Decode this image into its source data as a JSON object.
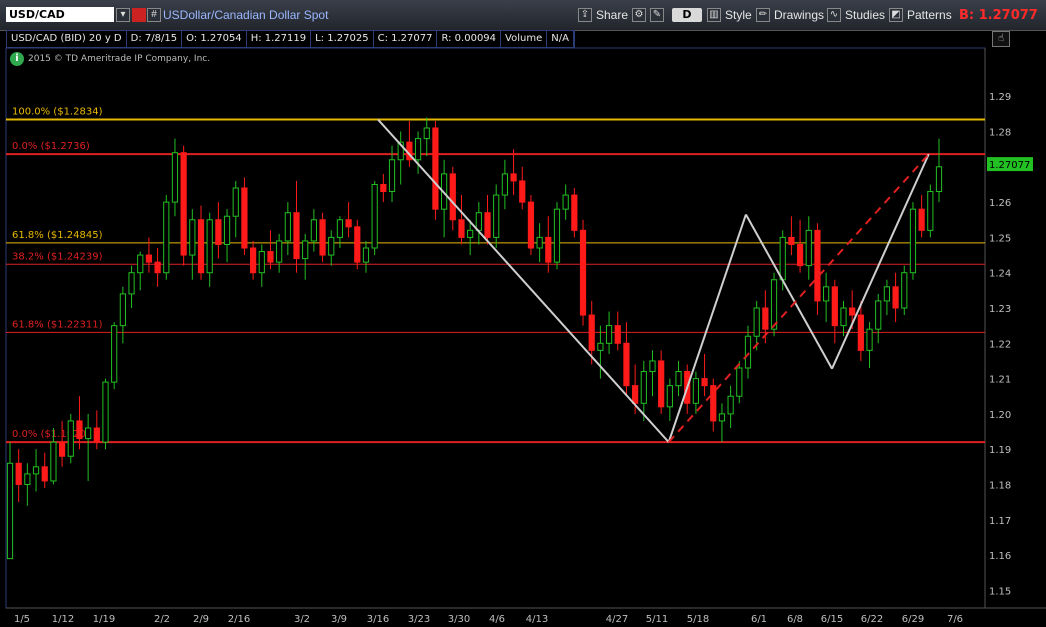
{
  "toolbar": {
    "symbol": "USD/CAD",
    "description": "USDollar/Canadian Dollar Spot",
    "share": "Share",
    "period_button": "D",
    "style": "Style",
    "drawings": "Drawings",
    "studies": "Studies",
    "patterns": "Patterns",
    "bid_label": "B: 1.27077",
    "hash_button": "#"
  },
  "info": {
    "instrument": "USD/CAD (BID) 20 y D",
    "date": "D: 7/8/15",
    "open": "O: 1.27054",
    "high": "H: 1.27119",
    "low": "L: 1.27025",
    "close": "C: 1.27077",
    "range": "R: 0.00094",
    "volume": "Volume",
    "na": "N/A"
  },
  "copyright": "2015 © TD Ameritrade IP Company, Inc.",
  "colors": {
    "up": "#22c022",
    "down": "#ff1a1a",
    "fib_gold": "#e8b800",
    "fib_red": "#e02020",
    "pattern": "#cfcfcf"
  },
  "chart_data": {
    "type": "candlestick",
    "ylim": [
      1.145,
      1.298
    ],
    "y_ticks": [
      1.29,
      1.28,
      1.27,
      1.26,
      1.25,
      1.24,
      1.23,
      1.22,
      1.21,
      1.2,
      1.19,
      1.18,
      1.17,
      1.16,
      1.15
    ],
    "x_ticks": [
      "1/5",
      "1/12",
      "1/19",
      "2/2",
      "2/9",
      "2/16",
      "3/2",
      "3/9",
      "3/16",
      "3/23",
      "3/30",
      "4/6",
      "4/13",
      "4/27",
      "5/11",
      "5/18",
      "6/1",
      "6/8",
      "6/15",
      "6/22",
      "6/29",
      "7/6"
    ],
    "last_price": "1.27077",
    "fib_levels": [
      {
        "label": "100.0%  ($1.2834)",
        "value": 1.2834,
        "color": "gold",
        "thick": true
      },
      {
        "label": "0.0%  ($1.2736)",
        "value": 1.2736,
        "color": "red",
        "thick": true
      },
      {
        "label": "61.8%  ($1.24845)",
        "value": 1.24845,
        "color": "gold",
        "thick": false
      },
      {
        "label": "38.2%  ($1.24239)",
        "value": 1.24239,
        "color": "red",
        "thick": false
      },
      {
        "label": "61.8%  ($1.22311)",
        "value": 1.22311,
        "color": "red",
        "thick": false
      },
      {
        "label": "0.0%  ($1.1920)",
        "value": 1.192,
        "color": "red",
        "thick": true
      }
    ],
    "pattern_lines": [
      {
        "from": [
          "3/16",
          1.2834
        ],
        "to": [
          "5/13",
          1.192
        ],
        "style": "solid"
      },
      {
        "from": [
          "5/13",
          1.192
        ],
        "to": [
          "5/29",
          1.2565
        ],
        "style": "solid"
      },
      {
        "from": [
          "5/29",
          1.2565
        ],
        "to": [
          "6/15",
          1.2128
        ],
        "style": "solid"
      },
      {
        "from": [
          "6/15",
          1.2128
        ],
        "to": [
          "7/1",
          1.2736
        ],
        "style": "solid"
      },
      {
        "from": [
          "5/13",
          1.192
        ],
        "to": [
          "7/1",
          1.2736
        ],
        "style": "dashed"
      }
    ],
    "candles": [
      [
        1.159,
        1.192,
        1.16,
        1.186
      ],
      [
        1.186,
        1.19,
        1.175,
        1.18
      ],
      [
        1.18,
        1.186,
        1.174,
        1.183
      ],
      [
        1.183,
        1.19,
        1.178,
        1.185
      ],
      [
        1.185,
        1.189,
        1.179,
        1.181
      ],
      [
        1.181,
        1.196,
        1.18,
        1.192
      ],
      [
        1.192,
        1.198,
        1.185,
        1.188
      ],
      [
        1.188,
        1.2,
        1.186,
        1.198
      ],
      [
        1.198,
        1.205,
        1.19,
        1.193
      ],
      [
        1.193,
        1.2,
        1.181,
        1.196
      ],
      [
        1.196,
        1.201,
        1.19,
        1.192
      ],
      [
        1.192,
        1.21,
        1.19,
        1.209
      ],
      [
        1.209,
        1.226,
        1.207,
        1.225
      ],
      [
        1.225,
        1.236,
        1.22,
        1.234
      ],
      [
        1.234,
        1.242,
        1.23,
        1.24
      ],
      [
        1.24,
        1.246,
        1.235,
        1.245
      ],
      [
        1.245,
        1.25,
        1.24,
        1.243
      ],
      [
        1.243,
        1.247,
        1.236,
        1.24
      ],
      [
        1.24,
        1.262,
        1.238,
        1.26
      ],
      [
        1.26,
        1.278,
        1.256,
        1.274
      ],
      [
        1.274,
        1.276,
        1.242,
        1.245
      ],
      [
        1.245,
        1.258,
        1.238,
        1.255
      ],
      [
        1.255,
        1.259,
        1.238,
        1.24
      ],
      [
        1.24,
        1.257,
        1.236,
        1.255
      ],
      [
        1.255,
        1.26,
        1.244,
        1.248
      ],
      [
        1.248,
        1.258,
        1.243,
        1.256
      ],
      [
        1.256,
        1.266,
        1.25,
        1.264
      ],
      [
        1.264,
        1.267,
        1.245,
        1.247
      ],
      [
        1.247,
        1.249,
        1.238,
        1.24
      ],
      [
        1.24,
        1.248,
        1.236,
        1.246
      ],
      [
        1.246,
        1.252,
        1.241,
        1.243
      ],
      [
        1.243,
        1.251,
        1.24,
        1.249
      ],
      [
        1.249,
        1.26,
        1.245,
        1.257
      ],
      [
        1.257,
        1.266,
        1.24,
        1.244
      ],
      [
        1.244,
        1.251,
        1.238,
        1.249
      ],
      [
        1.249,
        1.258,
        1.246,
        1.255
      ],
      [
        1.255,
        1.257,
        1.243,
        1.245
      ],
      [
        1.245,
        1.252,
        1.242,
        1.25
      ],
      [
        1.25,
        1.256,
        1.247,
        1.255
      ],
      [
        1.255,
        1.26,
        1.25,
        1.253
      ],
      [
        1.253,
        1.255,
        1.241,
        1.243
      ],
      [
        1.243,
        1.249,
        1.24,
        1.247
      ],
      [
        1.247,
        1.266,
        1.245,
        1.265
      ],
      [
        1.265,
        1.268,
        1.26,
        1.263
      ],
      [
        1.263,
        1.276,
        1.26,
        1.272
      ],
      [
        1.272,
        1.28,
        1.265,
        1.277
      ],
      [
        1.277,
        1.283,
        1.27,
        1.272
      ],
      [
        1.272,
        1.28,
        1.268,
        1.278
      ],
      [
        1.278,
        1.284,
        1.273,
        1.281
      ],
      [
        1.281,
        1.283,
        1.255,
        1.258
      ],
      [
        1.258,
        1.272,
        1.25,
        1.268
      ],
      [
        1.268,
        1.27,
        1.252,
        1.255
      ],
      [
        1.255,
        1.262,
        1.248,
        1.25
      ],
      [
        1.25,
        1.255,
        1.245,
        1.252
      ],
      [
        1.252,
        1.26,
        1.248,
        1.257
      ],
      [
        1.257,
        1.262,
        1.248,
        1.25
      ],
      [
        1.25,
        1.265,
        1.247,
        1.262
      ],
      [
        1.262,
        1.272,
        1.258,
        1.268
      ],
      [
        1.268,
        1.275,
        1.262,
        1.266
      ],
      [
        1.266,
        1.27,
        1.258,
        1.26
      ],
      [
        1.26,
        1.262,
        1.245,
        1.247
      ],
      [
        1.247,
        1.254,
        1.243,
        1.25
      ],
      [
        1.25,
        1.256,
        1.24,
        1.243
      ],
      [
        1.243,
        1.26,
        1.241,
        1.258
      ],
      [
        1.258,
        1.265,
        1.255,
        1.262
      ],
      [
        1.262,
        1.264,
        1.25,
        1.252
      ],
      [
        1.252,
        1.255,
        1.225,
        1.228
      ],
      [
        1.228,
        1.232,
        1.214,
        1.218
      ],
      [
        1.218,
        1.225,
        1.21,
        1.22
      ],
      [
        1.22,
        1.229,
        1.217,
        1.225
      ],
      [
        1.225,
        1.229,
        1.218,
        1.22
      ],
      [
        1.22,
        1.226,
        1.205,
        1.208
      ],
      [
        1.208,
        1.214,
        1.2,
        1.203
      ],
      [
        1.203,
        1.215,
        1.198,
        1.212
      ],
      [
        1.212,
        1.218,
        1.205,
        1.215
      ],
      [
        1.215,
        1.218,
        1.2,
        1.202
      ],
      [
        1.202,
        1.21,
        1.198,
        1.208
      ],
      [
        1.208,
        1.215,
        1.205,
        1.212
      ],
      [
        1.212,
        1.214,
        1.2,
        1.203
      ],
      [
        1.203,
        1.212,
        1.2,
        1.21
      ],
      [
        1.21,
        1.217,
        1.205,
        1.208
      ],
      [
        1.208,
        1.21,
        1.195,
        1.198
      ],
      [
        1.198,
        1.203,
        1.192,
        1.2
      ],
      [
        1.2,
        1.208,
        1.196,
        1.205
      ],
      [
        1.205,
        1.215,
        1.203,
        1.213
      ],
      [
        1.213,
        1.225,
        1.21,
        1.222
      ],
      [
        1.222,
        1.232,
        1.218,
        1.23
      ],
      [
        1.23,
        1.235,
        1.22,
        1.224
      ],
      [
        1.224,
        1.24,
        1.222,
        1.238
      ],
      [
        1.238,
        1.252,
        1.235,
        1.25
      ],
      [
        1.25,
        1.256,
        1.245,
        1.248
      ],
      [
        1.248,
        1.255,
        1.24,
        1.242
      ],
      [
        1.242,
        1.256,
        1.238,
        1.252
      ],
      [
        1.252,
        1.254,
        1.228,
        1.232
      ],
      [
        1.232,
        1.24,
        1.226,
        1.236
      ],
      [
        1.236,
        1.238,
        1.22,
        1.225
      ],
      [
        1.225,
        1.232,
        1.222,
        1.23
      ],
      [
        1.23,
        1.235,
        1.224,
        1.228
      ],
      [
        1.228,
        1.232,
        1.215,
        1.218
      ],
      [
        1.218,
        1.226,
        1.213,
        1.224
      ],
      [
        1.224,
        1.234,
        1.22,
        1.232
      ],
      [
        1.232,
        1.238,
        1.228,
        1.236
      ],
      [
        1.236,
        1.24,
        1.226,
        1.23
      ],
      [
        1.23,
        1.242,
        1.228,
        1.24
      ],
      [
        1.24,
        1.26,
        1.238,
        1.258
      ],
      [
        1.258,
        1.262,
        1.25,
        1.252
      ],
      [
        1.252,
        1.265,
        1.25,
        1.263
      ],
      [
        1.263,
        1.278,
        1.26,
        1.27
      ]
    ]
  }
}
